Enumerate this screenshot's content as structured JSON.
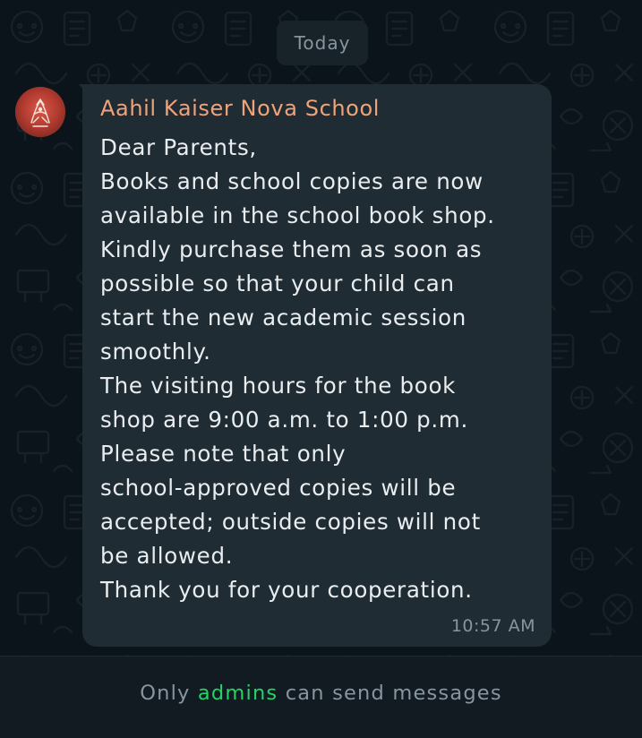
{
  "date_chip": "Today",
  "message": {
    "sender": "Aahil Kaiser Nova School",
    "lines": [
      "Dear Parents,",
      "Books and school copies are now",
      "available in the school book shop.",
      "Kindly purchase them as soon as",
      "possible so that your child can",
      "start the new academic session",
      "smoothly.",
      "The visiting hours for the book",
      "shop are 9:00 a.m. to 1:00 p.m.",
      "Please note that only",
      "school-approved copies will be",
      "accepted; outside copies will not",
      "be allowed.",
      "Thank you for your cooperation."
    ],
    "time": "10:57 AM"
  },
  "footer": {
    "prefix": "Only",
    "link": "admins",
    "suffix": "can send messages"
  },
  "colors": {
    "chat_background": "#0b141a",
    "bubble": "#202c33",
    "sender_name": "#f0a37a",
    "message_text": "#e9edef",
    "muted_text": "#8696a0",
    "admins_link": "#25d366",
    "footer_background": "#111b21"
  },
  "icons": {
    "avatar": "school-logo-avatar",
    "wallpaper": "doodle-wallpaper"
  }
}
